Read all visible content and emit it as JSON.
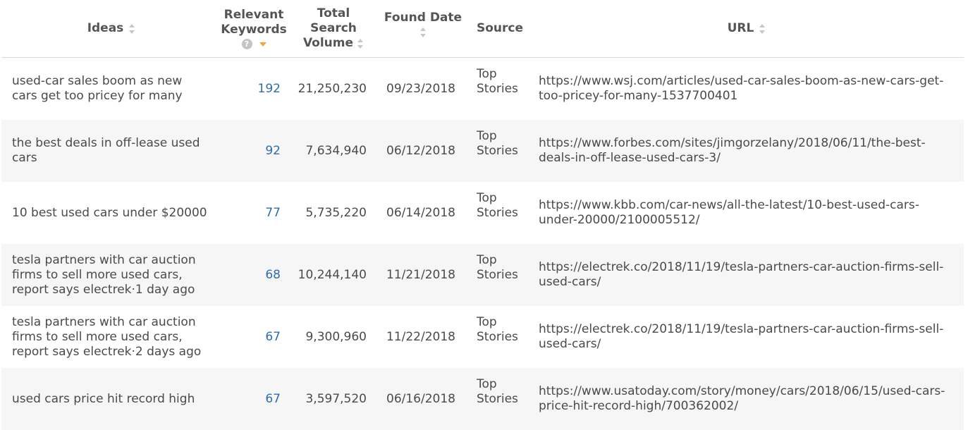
{
  "columns": {
    "ideas": "Ideas",
    "keywords_line1": "Relevant",
    "keywords_line2": "Keywords",
    "keywords_help": "?",
    "volume_line1": "Total",
    "volume_line2": "Search",
    "volume_line3": "Volume",
    "found_date": "Found Date",
    "source": "Source",
    "url": "URL"
  },
  "sort": {
    "active_column": "Relevant Keywords",
    "direction": "descending",
    "active_color": "#f5a33c",
    "keyword_link_color": "#2f6cab"
  },
  "rows": [
    {
      "idea": "used-car sales boom as new cars get too pricey for many",
      "keywords": "192",
      "volume": "21,250,230",
      "date": "09/23/2018",
      "source": "Top Stories",
      "url": "https://www.wsj.com/articles/used-car-sales-boom-as-new-cars-get-too-pricey-for-many-1537700401"
    },
    {
      "idea": "the best deals in off-lease used cars",
      "keywords": "92",
      "volume": "7,634,940",
      "date": "06/12/2018",
      "source": "Top Stories",
      "url": "https://www.forbes.com/sites/jimgorzelany/2018/06/11/the-best-deals-in-off-lease-used-cars-3/"
    },
    {
      "idea": "10 best used cars under $20000",
      "keywords": "77",
      "volume": "5,735,220",
      "date": "06/14/2018",
      "source": "Top Stories",
      "url": "https://www.kbb.com/car-news/all-the-latest/10-best-used-cars-under-20000/2100005512/"
    },
    {
      "idea": "tesla partners with car auction firms to sell more used cars, report says electrek·1 day ago",
      "keywords": "68",
      "volume": "10,244,140",
      "date": "11/21/2018",
      "source": "Top Stories",
      "url": "https://electrek.co/2018/11/19/tesla-partners-car-auction-firms-sell-used-cars/"
    },
    {
      "idea": "tesla partners with car auction firms to sell more used cars, report says electrek·2 days ago",
      "keywords": "67",
      "volume": "9,300,960",
      "date": "11/22/2018",
      "source": "Top Stories",
      "url": "https://electrek.co/2018/11/19/tesla-partners-car-auction-firms-sell-used-cars/"
    },
    {
      "idea": "used cars price hit record high",
      "keywords": "67",
      "volume": "3,597,520",
      "date": "06/16/2018",
      "source": "Top Stories",
      "url": "https://www.usatoday.com/story/money/cars/2018/06/15/used-cars-price-hit-record-high/700362002/"
    }
  ]
}
